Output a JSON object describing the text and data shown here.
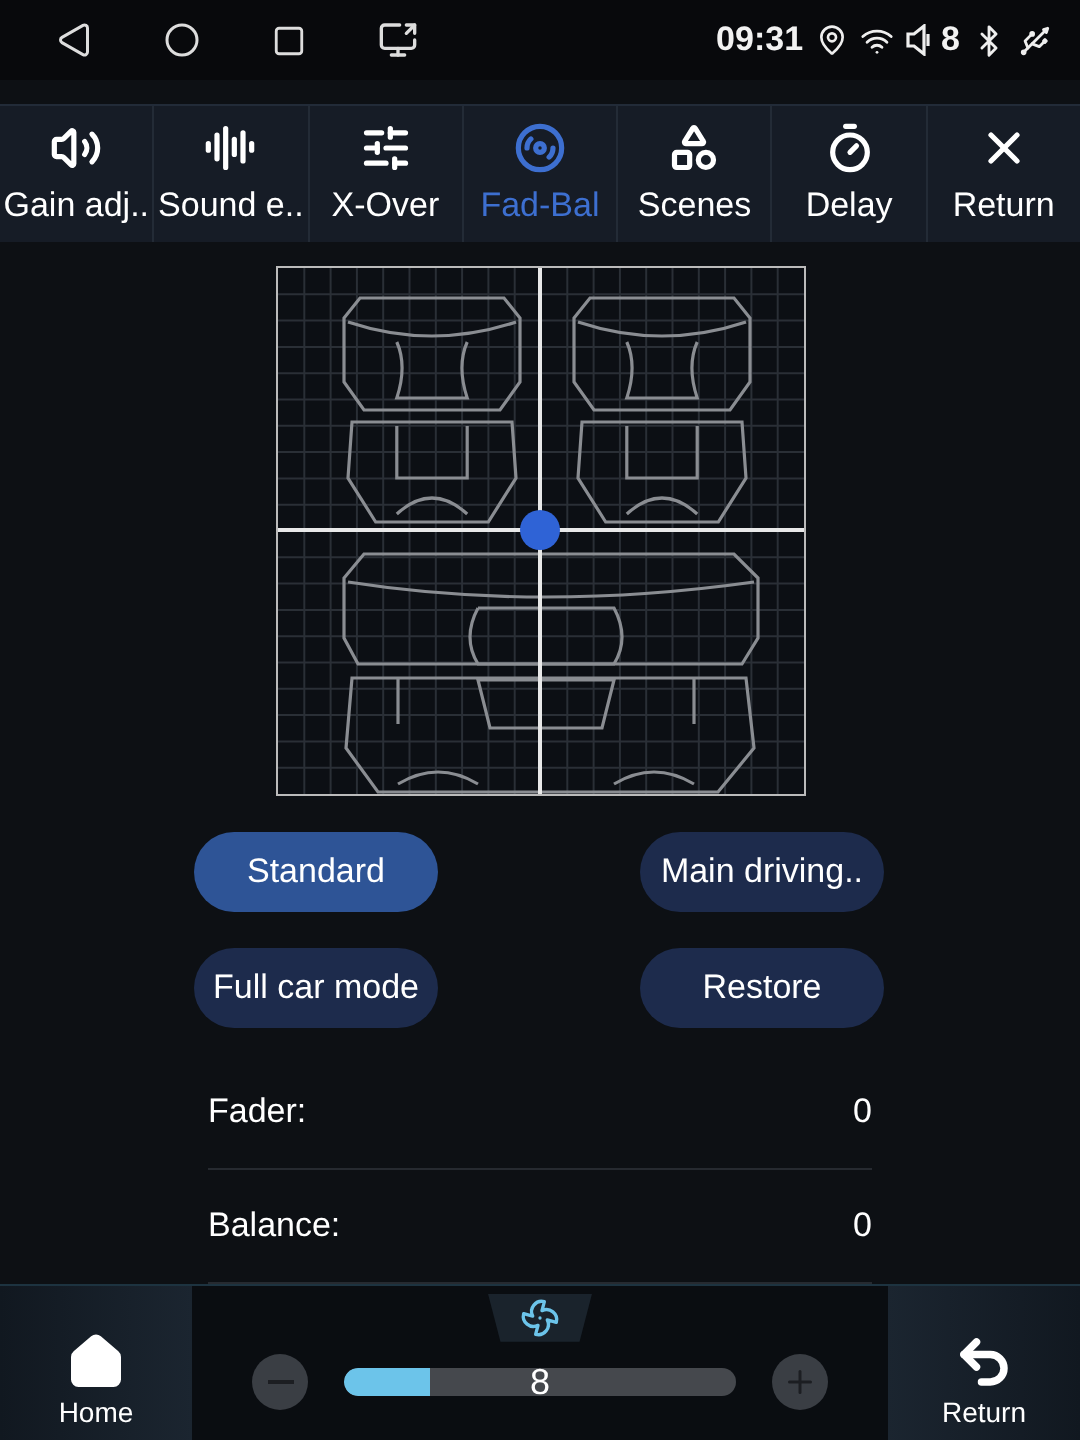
{
  "status_bar": {
    "time": "09:31",
    "volume": "8"
  },
  "tabs": [
    {
      "label": "Gain adj..",
      "selected": false
    },
    {
      "label": "Sound e..",
      "selected": false
    },
    {
      "label": "X-Over",
      "selected": false
    },
    {
      "label": "Fad-Bal",
      "selected": true
    },
    {
      "label": "Scenes",
      "selected": false
    },
    {
      "label": "Delay",
      "selected": false
    },
    {
      "label": "Return",
      "selected": false
    }
  ],
  "modes": [
    {
      "label": "Standard",
      "selected": true
    },
    {
      "label": "Main driving..",
      "selected": false
    },
    {
      "label": "Full car mode",
      "selected": false
    },
    {
      "label": "Restore",
      "selected": false
    }
  ],
  "readings": [
    {
      "label": "Fader:",
      "value": "0"
    },
    {
      "label": "Balance:",
      "value": "0"
    }
  ],
  "dock": {
    "home": "Home",
    "back": "Return",
    "fan": {
      "value": "8",
      "level": 0.22
    }
  }
}
